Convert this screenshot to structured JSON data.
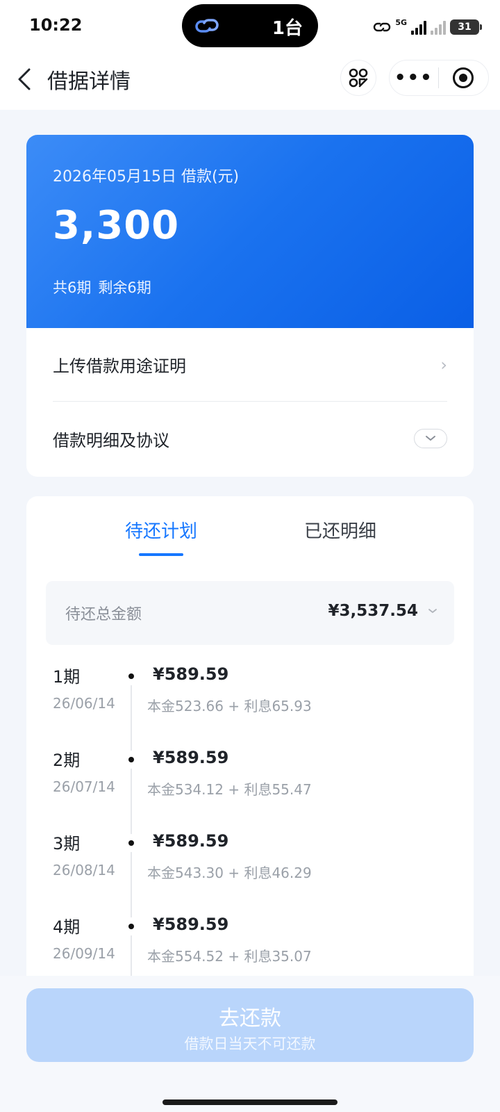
{
  "status_bar": {
    "time": "10:22",
    "island_count": "1台",
    "network": "5G",
    "battery": "31"
  },
  "nav": {
    "title": "借据详情",
    "back_icon": "chevron-left-icon",
    "scan_icon": "scan-icon",
    "more_icon": "more-icon",
    "close_icon": "target-icon"
  },
  "loan": {
    "date_label": "2026年05月15日 借款(元)",
    "amount": "3,300",
    "total_periods": "共6期",
    "remaining_periods": "剩余6期"
  },
  "links": {
    "upload_proof": "上传借款用途证明",
    "details_agreement": "借款明细及协议"
  },
  "tabs": {
    "pending": "待还计划",
    "repaid": "已还明细"
  },
  "summary": {
    "label": "待还总金额",
    "value": "¥3,537.54"
  },
  "installments": [
    {
      "period": "1期",
      "date": "26/06/14",
      "amount": "¥589.59",
      "detail": "本金523.66 + 利息65.93"
    },
    {
      "period": "2期",
      "date": "26/07/14",
      "amount": "¥589.59",
      "detail": "本金534.12 + 利息55.47"
    },
    {
      "period": "3期",
      "date": "26/08/14",
      "amount": "¥589.59",
      "detail": "本金543.30 + 利息46.29"
    },
    {
      "period": "4期",
      "date": "26/09/14",
      "amount": "¥589.59",
      "detail": "本金554.52 + 利息35.07"
    }
  ],
  "pay_button": {
    "label": "去还款",
    "sublabel": "借款日当天不可还款"
  },
  "colors": {
    "accent": "#1677ff",
    "card_gradient_start": "#3c8cf7",
    "card_gradient_end": "#0a5fe6",
    "pay_button_disabled": "#b9d5fb"
  }
}
